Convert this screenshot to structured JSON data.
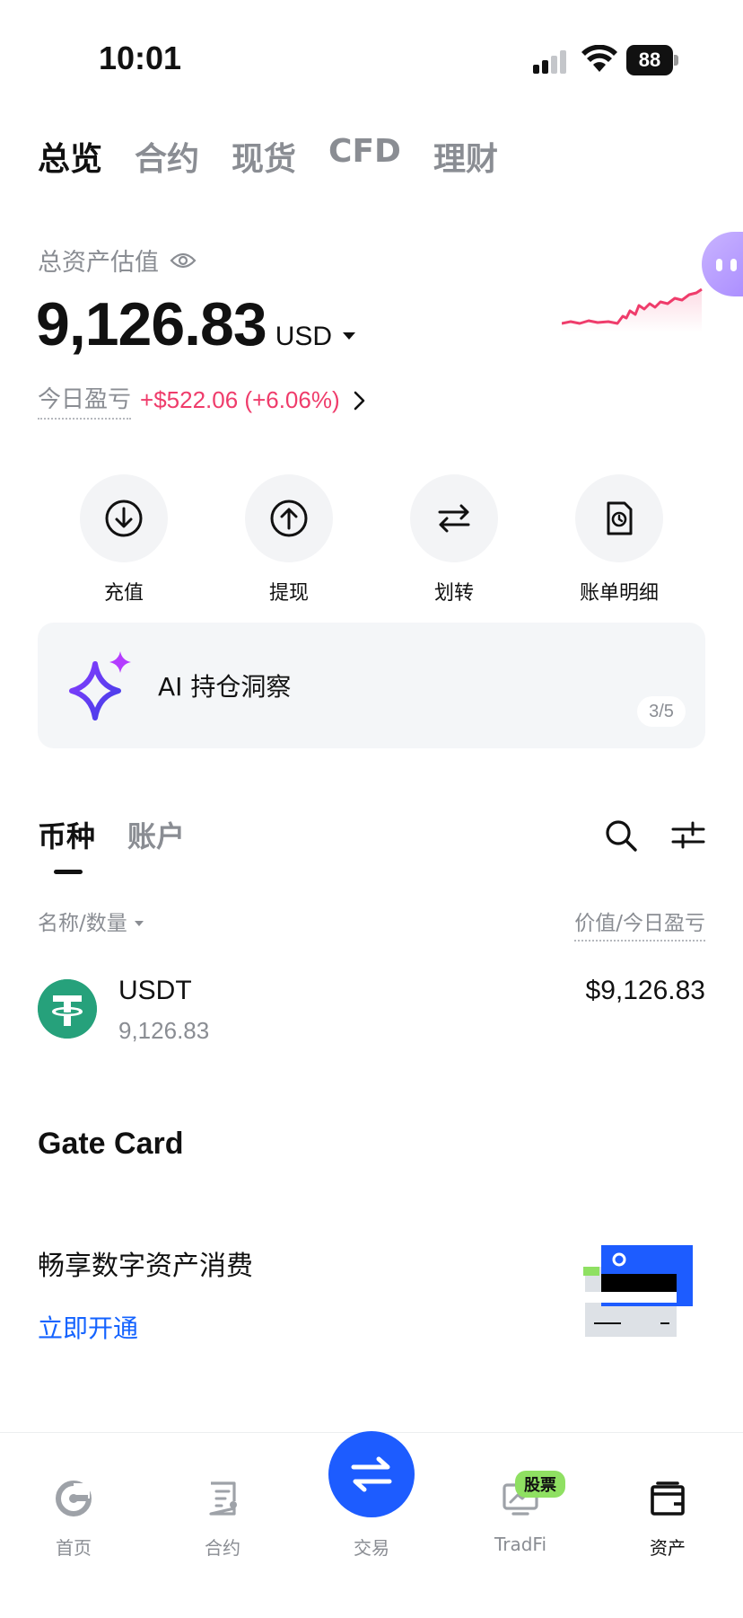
{
  "status_bar": {
    "time": "10:01",
    "battery": "88"
  },
  "top_tabs": [
    {
      "label": "总览",
      "active": true
    },
    {
      "label": "合约",
      "active": false
    },
    {
      "label": "现货",
      "active": false
    },
    {
      "label": "CFD",
      "active": false
    },
    {
      "label": "理财",
      "active": false
    }
  ],
  "summary": {
    "label": "总资产估值",
    "value": "9,126.83",
    "unit": "USD",
    "pnl_label": "今日盈亏",
    "pnl_value": "+$522.06 (+6.06%)"
  },
  "actions": [
    {
      "label": "充值",
      "icon": "deposit-icon"
    },
    {
      "label": "提现",
      "icon": "withdraw-icon"
    },
    {
      "label": "划转",
      "icon": "transfer-icon"
    },
    {
      "label": "账单明细",
      "icon": "bill-icon"
    }
  ],
  "ai_card": {
    "text": "AI 持仓洞察",
    "page": "3/5"
  },
  "coin_tabs": [
    {
      "label": "币种",
      "active": true
    },
    {
      "label": "账户",
      "active": false
    }
  ],
  "list_header": {
    "left": "名称/数量",
    "right": "价值/今日盈亏"
  },
  "holdings": [
    {
      "symbol": "USDT",
      "quantity": "9,126.83",
      "value": "$9,126.83"
    }
  ],
  "gate_card": {
    "title": "Gate Card",
    "desc": "畅享数字资产消费",
    "cta": "立即开通"
  },
  "bottom_nav": [
    {
      "label": "首页",
      "icon": "home-icon"
    },
    {
      "label": "合约",
      "icon": "futures-icon"
    },
    {
      "label": "交易",
      "icon": "trade-icon"
    },
    {
      "label": "TradFi",
      "icon": "tradfi-icon",
      "badge": "股票"
    },
    {
      "label": "资产",
      "icon": "wallet-icon",
      "active": true
    }
  ],
  "colors": {
    "accent_blue": "#1d5cff",
    "positive_red": "#ef3c6b",
    "usdt_green": "#26a17b",
    "badge_green": "#8fe062"
  }
}
